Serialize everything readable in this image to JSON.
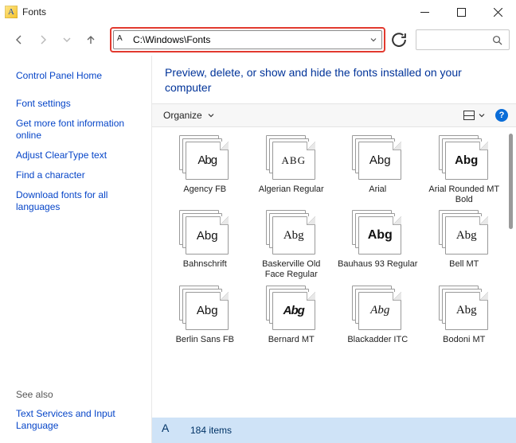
{
  "window": {
    "title": "Fonts"
  },
  "address": {
    "path": "C:\\Windows\\Fonts"
  },
  "sidebar": {
    "home": "Control Panel Home",
    "links": [
      "Font settings",
      "Get more font information online",
      "Adjust ClearType text",
      "Find a character",
      "Download fonts for all languages"
    ],
    "seealso_label": "See also",
    "seealso_links": [
      "Text Services and Input Language"
    ]
  },
  "heading": "Preview, delete, or show and hide the fonts installed on your computer",
  "toolbar": {
    "organize": "Organize"
  },
  "fonts": [
    {
      "name": "Agency FB",
      "sample": "Abg",
      "cls": "st-cond"
    },
    {
      "name": "Algerian Regular",
      "sample": "ABG",
      "cls": "st-alg"
    },
    {
      "name": "Arial",
      "sample": "Abg",
      "cls": "st-narrow"
    },
    {
      "name": "Arial Rounded MT Bold",
      "sample": "Abg",
      "cls": "st-round"
    },
    {
      "name": "Bahnschrift",
      "sample": "Abg",
      "cls": "st-bahn"
    },
    {
      "name": "Baskerville Old Face Regular",
      "sample": "Abg",
      "cls": "st-bask"
    },
    {
      "name": "Bauhaus 93 Regular",
      "sample": "Abg",
      "cls": "st-bauh"
    },
    {
      "name": "Bell MT",
      "sample": "Abg",
      "cls": "st-bell"
    },
    {
      "name": "Berlin Sans FB",
      "sample": "Abg",
      "cls": "st-berlin"
    },
    {
      "name": "Bernard MT",
      "sample": "Abg",
      "cls": "st-bern"
    },
    {
      "name": "Blackadder ITC",
      "sample": "Abg",
      "cls": "st-black"
    },
    {
      "name": "Bodoni MT",
      "sample": "Abg",
      "cls": "st-bod"
    }
  ],
  "status": {
    "count": "184 items"
  }
}
